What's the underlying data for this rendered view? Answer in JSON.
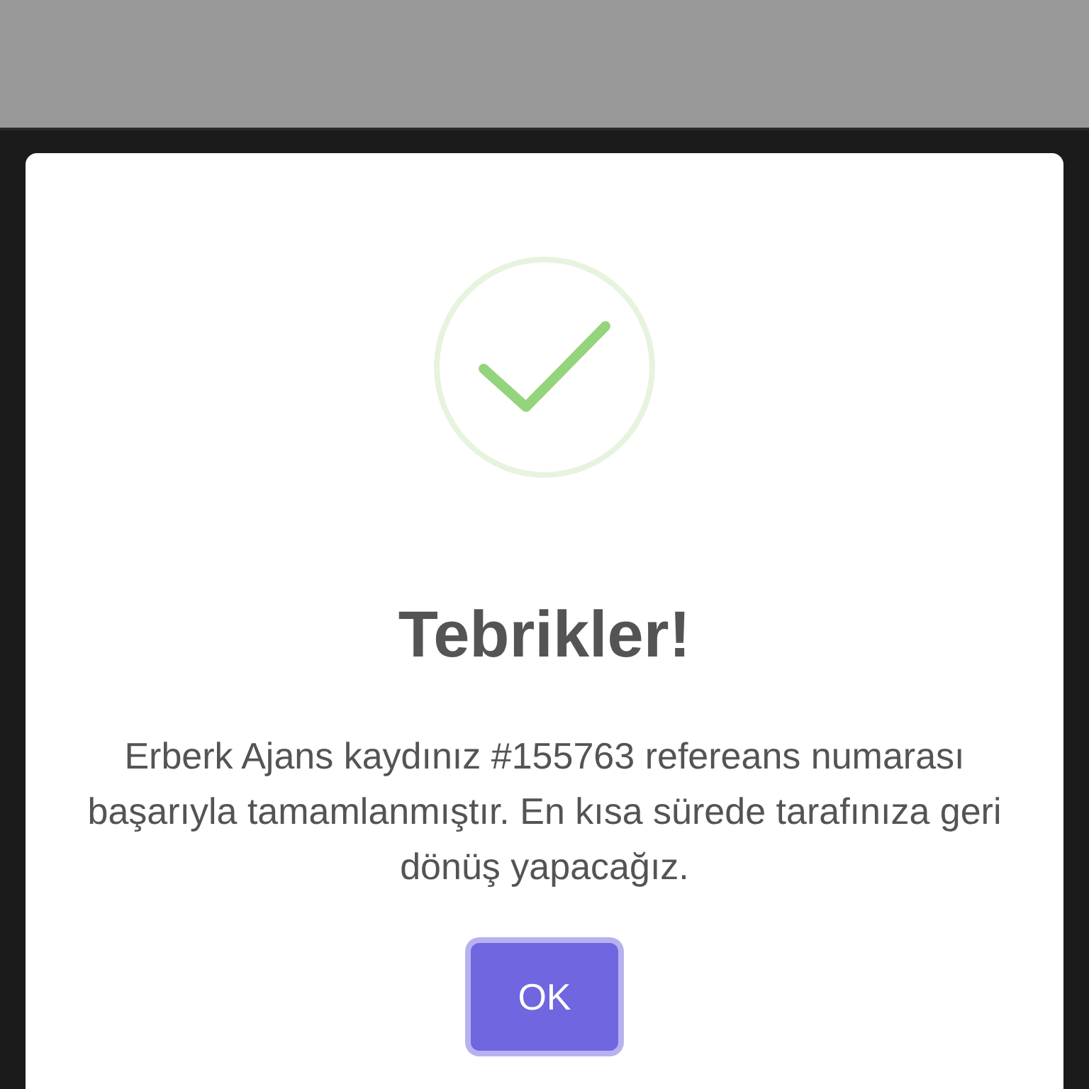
{
  "dialog": {
    "title": "Tebrikler!",
    "message": "Erberk Ajans kaydınız #155763 refereans numarası başarıyla tamamlanmıştır. En kısa sürede tarafınıza geri dönüş yapacağız.",
    "button": "OK"
  }
}
